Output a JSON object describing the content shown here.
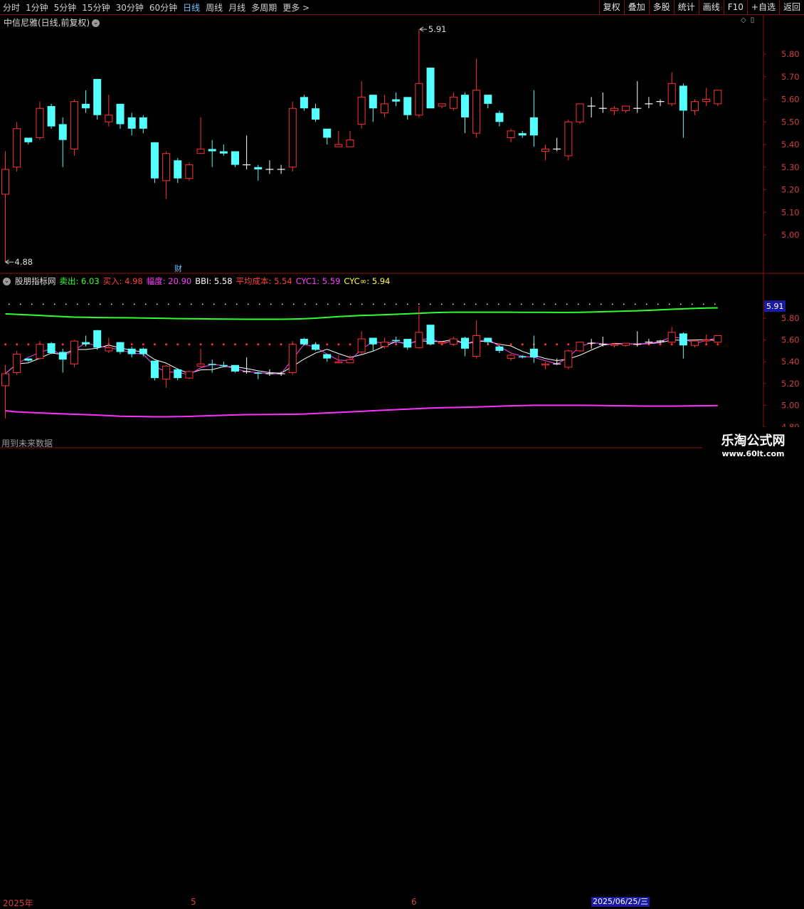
{
  "toolbar": {
    "periods": [
      "分时",
      "1分钟",
      "5分钟",
      "15分钟",
      "30分钟",
      "60分钟",
      "日线",
      "周线",
      "月线",
      "多周期",
      "更多 >"
    ],
    "active_period": "日线",
    "actions": [
      "复权",
      "叠加",
      "多股",
      "统计",
      "画线",
      "F10",
      "+自选",
      "返回"
    ]
  },
  "main_chart": {
    "title": "中信尼雅(日线,前复权)",
    "high_label": "5.91",
    "low_label": "4.88",
    "event_marker": "财",
    "y_ticks": [
      "5.80",
      "5.70",
      "5.60",
      "5.50",
      "5.40",
      "5.30",
      "5.20",
      "5.10",
      "5.00"
    ]
  },
  "indicator": {
    "name": "股朋指标网",
    "items": [
      {
        "label": "卖出:",
        "value": "6.03",
        "color": "#40ff40"
      },
      {
        "label": "买入:",
        "value": "4.98",
        "color": "#ff4040"
      },
      {
        "label": "幅度:",
        "value": "20.90",
        "color": "#ff40ff"
      },
      {
        "label": "BBI:",
        "value": "5.58",
        "color": "#ffffff"
      },
      {
        "label": "平均成本:",
        "value": "5.54",
        "color": "#ff4040"
      },
      {
        "label": "CYC1:",
        "value": "5.59",
        "color": "#ff40ff"
      },
      {
        "label": "CYC∞:",
        "value": "5.94",
        "color": "#ffff40"
      }
    ],
    "y_ticks": [
      "5.91",
      "5.80",
      "5.60",
      "5.40",
      "5.20",
      "5.00",
      "4.80"
    ]
  },
  "footer": {
    "future_data": "用到未来数据",
    "x_labels": [
      "2025年",
      "5",
      "6"
    ],
    "current_date": "2025/06/25/三"
  },
  "watermark": {
    "line1": "乐淘公式网",
    "line2": "www.60lt.com"
  },
  "chart_data": {
    "type": "candlestick",
    "title": "中信尼雅(日线,前复权)",
    "series": [
      {
        "name": "candles",
        "values": [
          [
            5.18,
            5.29,
            5.37,
            4.88
          ],
          [
            5.3,
            5.47,
            5.5,
            5.28
          ],
          [
            5.43,
            5.41,
            5.43,
            5.4
          ],
          [
            5.43,
            5.56,
            5.59,
            5.42
          ],
          [
            5.57,
            5.48,
            5.58,
            5.47
          ],
          [
            5.49,
            5.42,
            5.52,
            5.3
          ],
          [
            5.38,
            5.59,
            5.6,
            5.35
          ],
          [
            5.58,
            5.56,
            5.64,
            5.54
          ],
          [
            5.69,
            5.53,
            5.69,
            5.51
          ],
          [
            5.5,
            5.53,
            5.62,
            5.48
          ],
          [
            5.58,
            5.49,
            5.58,
            5.47
          ],
          [
            5.52,
            5.47,
            5.54,
            5.44
          ],
          [
            5.52,
            5.47,
            5.53,
            5.45
          ],
          [
            5.41,
            5.25,
            5.41,
            5.23
          ],
          [
            5.24,
            5.36,
            5.37,
            5.16
          ],
          [
            5.33,
            5.25,
            5.34,
            5.23
          ],
          [
            5.25,
            5.31,
            5.32,
            5.24
          ],
          [
            5.36,
            5.38,
            5.52,
            5.36
          ],
          [
            5.38,
            5.37,
            5.42,
            5.3
          ],
          [
            5.37,
            5.36,
            5.4,
            5.35
          ],
          [
            5.37,
            5.31,
            5.37,
            5.3
          ],
          [
            5.31,
            5.31,
            5.44,
            5.29
          ],
          [
            5.3,
            5.29,
            5.31,
            5.24
          ],
          [
            5.29,
            5.29,
            5.33,
            5.27
          ],
          [
            5.29,
            5.29,
            5.31,
            5.27
          ],
          [
            5.3,
            5.56,
            5.59,
            5.28
          ],
          [
            5.61,
            5.56,
            5.62,
            5.55
          ],
          [
            5.56,
            5.51,
            5.58,
            5.5
          ],
          [
            5.47,
            5.43,
            5.47,
            5.4
          ],
          [
            5.39,
            5.4,
            5.46,
            5.39
          ],
          [
            5.39,
            5.42,
            5.46,
            5.39
          ],
          [
            5.49,
            5.61,
            5.68,
            5.47
          ],
          [
            5.62,
            5.56,
            5.62,
            5.5
          ],
          [
            5.54,
            5.58,
            5.62,
            5.52
          ],
          [
            5.6,
            5.59,
            5.63,
            5.57
          ],
          [
            5.61,
            5.53,
            5.61,
            5.51
          ],
          [
            5.53,
            5.67,
            5.91,
            5.52
          ],
          [
            5.74,
            5.56,
            5.74,
            5.56
          ],
          [
            5.57,
            5.58,
            5.58,
            5.56
          ],
          [
            5.56,
            5.61,
            5.63,
            5.55
          ],
          [
            5.62,
            5.52,
            5.63,
            5.45
          ],
          [
            5.45,
            5.64,
            5.78,
            5.43
          ],
          [
            5.62,
            5.58,
            5.62,
            5.56
          ],
          [
            5.54,
            5.5,
            5.55,
            5.48
          ],
          [
            5.43,
            5.46,
            5.47,
            5.41
          ],
          [
            5.45,
            5.44,
            5.46,
            5.43
          ],
          [
            5.52,
            5.44,
            5.64,
            5.39
          ],
          [
            5.37,
            5.38,
            5.4,
            5.33
          ],
          [
            5.38,
            5.38,
            5.43,
            5.37
          ],
          [
            5.35,
            5.5,
            5.51,
            5.33
          ],
          [
            5.5,
            5.58,
            5.58,
            5.49
          ],
          [
            5.57,
            5.57,
            5.61,
            5.52
          ],
          [
            5.56,
            5.56,
            5.63,
            5.54
          ],
          [
            5.55,
            5.56,
            5.57,
            5.53
          ],
          [
            5.55,
            5.57,
            5.57,
            5.54
          ],
          [
            5.56,
            5.56,
            5.68,
            5.54
          ],
          [
            5.58,
            5.58,
            5.61,
            5.56
          ],
          [
            5.59,
            5.59,
            5.6,
            5.57
          ],
          [
            5.58,
            5.67,
            5.72,
            5.57
          ],
          [
            5.66,
            5.55,
            5.67,
            5.43
          ],
          [
            5.55,
            5.59,
            5.6,
            5.53
          ],
          [
            5.59,
            5.6,
            5.65,
            5.57
          ],
          [
            5.58,
            5.64,
            5.64,
            5.57
          ]
        ]
      },
      {
        "name": "卖出",
        "values": [
          5.84,
          5.835,
          5.83,
          5.825,
          5.82,
          5.815,
          5.81,
          5.808,
          5.806,
          5.805,
          5.804,
          5.803,
          5.802,
          5.8,
          5.798,
          5.796,
          5.795,
          5.794,
          5.793,
          5.792,
          5.791,
          5.79,
          5.79,
          5.79,
          5.79,
          5.792,
          5.795,
          5.8,
          5.807,
          5.815,
          5.82,
          5.825,
          5.828,
          5.832,
          5.836,
          5.84,
          5.845,
          5.85,
          5.853,
          5.855,
          5.855,
          5.855,
          5.855,
          5.855,
          5.855,
          5.854,
          5.854,
          5.854,
          5.853,
          5.853,
          5.854,
          5.856,
          5.86,
          5.862,
          5.865,
          5.868,
          5.872,
          5.877,
          5.882,
          5.886,
          5.89,
          5.893,
          5.895
        ]
      },
      {
        "name": "买入",
        "values": [
          4.95,
          4.94,
          4.935,
          4.93,
          4.926,
          4.922,
          4.918,
          4.914,
          4.91,
          4.905,
          4.9,
          4.898,
          4.896,
          4.895,
          4.895,
          4.896,
          4.898,
          4.902,
          4.905,
          4.909,
          4.912,
          4.914,
          4.915,
          4.916,
          4.917,
          4.918,
          4.92,
          4.925,
          4.93,
          4.935,
          4.94,
          4.945,
          4.95,
          4.955,
          4.96,
          4.965,
          4.97,
          4.975,
          4.978,
          4.98,
          4.982,
          4.985,
          4.988,
          4.992,
          4.995,
          4.998,
          5.0,
          5.0,
          5.0,
          5.0,
          5.0,
          4.999,
          4.998,
          4.996,
          4.995,
          4.994,
          4.993,
          4.993,
          4.993,
          4.994,
          4.995,
          4.996,
          4.998
        ]
      }
    ],
    "ylim": [
      4.8,
      5.91
    ]
  }
}
